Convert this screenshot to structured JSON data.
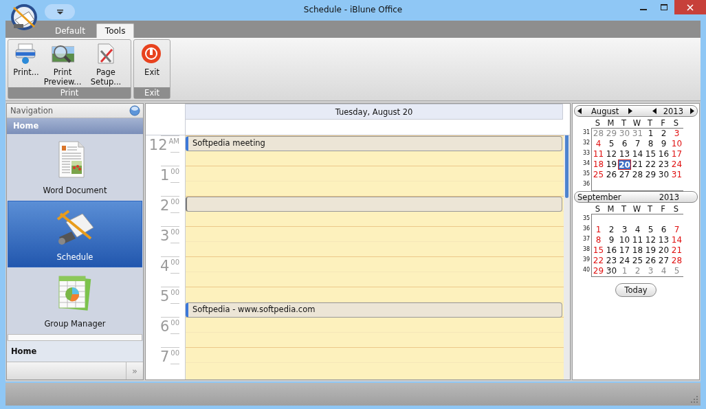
{
  "window": {
    "title": "Schedule - iBlune Office"
  },
  "ribbon": {
    "tabs": [
      {
        "label": "Default",
        "selected": false
      },
      {
        "label": "Tools",
        "selected": true
      }
    ],
    "groups": [
      {
        "label": "Print",
        "buttons": [
          {
            "label": "Print...",
            "kind": "printer"
          },
          {
            "label": "Print Preview...",
            "kind": "preview"
          },
          {
            "label": "Page Setup...",
            "kind": "setup"
          }
        ]
      },
      {
        "label": "Exit",
        "buttons": [
          {
            "label": "Exit",
            "kind": "exit"
          }
        ]
      }
    ]
  },
  "navigation": {
    "title": "Navigation",
    "section": "Home",
    "items": [
      {
        "label": "Word Document",
        "kind": "document",
        "selected": false
      },
      {
        "label": "Schedule",
        "kind": "schedule",
        "selected": true
      },
      {
        "label": "Group Manager",
        "kind": "spreadsheet",
        "selected": false
      }
    ],
    "footer": "Home",
    "more_button": "»"
  },
  "day_view": {
    "date": "Tuesday, August 20",
    "hours": [
      {
        "hour": "12",
        "suffix": "AM",
        "slots": [
          {
            "booked": true,
            "subject": "Softpedia meeting"
          },
          {
            "booked": false
          }
        ]
      },
      {
        "hour": "1",
        "suffix": "00",
        "slots": [
          {
            "booked": false
          },
          {
            "booked": false
          }
        ]
      },
      {
        "hour": "2",
        "suffix": "00",
        "slots": [
          {
            "booked": true
          },
          {
            "booked": false
          }
        ]
      },
      {
        "hour": "3",
        "suffix": "00",
        "slots": [
          {
            "booked": false
          },
          {
            "booked": false
          }
        ]
      },
      {
        "hour": "4",
        "suffix": "00",
        "slots": [
          {
            "booked": false
          },
          {
            "booked": false
          }
        ]
      },
      {
        "hour": "5",
        "suffix": "00",
        "slots": [
          {
            "booked": false
          },
          {
            "booked": true,
            "subject": "Softpedia - www.softpedia.com"
          }
        ]
      },
      {
        "hour": "6",
        "suffix": "00",
        "slots": [
          {
            "booked": false
          },
          {
            "booked": false
          }
        ]
      },
      {
        "hour": "7",
        "suffix": "00",
        "slots": [
          {
            "booked": false
          },
          {
            "booked": false
          }
        ]
      }
    ]
  },
  "mini_calendars": [
    {
      "month": "August",
      "year": "2013",
      "arrows": true,
      "weekdays": [
        "S",
        "M",
        "T",
        "W",
        "T",
        "F",
        "S"
      ],
      "weeks": [
        {
          "number": "31",
          "days": [
            {
              "d": "28",
              "kind": "other",
              "selected": false
            },
            {
              "d": "29",
              "kind": "other",
              "selected": false
            },
            {
              "d": "30",
              "kind": "other",
              "selected": false
            },
            {
              "d": "31",
              "kind": "other",
              "selected": false
            },
            {
              "d": "1",
              "kind": "weekday",
              "selected": false
            },
            {
              "d": "2",
              "kind": "weekday",
              "selected": false
            },
            {
              "d": "3",
              "kind": "weekend",
              "selected": false
            }
          ]
        },
        {
          "number": "32",
          "days": [
            {
              "d": "4",
              "kind": "weekend",
              "selected": false
            },
            {
              "d": "5",
              "kind": "weekday",
              "selected": false
            },
            {
              "d": "6",
              "kind": "weekday",
              "selected": false
            },
            {
              "d": "7",
              "kind": "weekday",
              "selected": false
            },
            {
              "d": "8",
              "kind": "weekday",
              "selected": false
            },
            {
              "d": "9",
              "kind": "weekday",
              "selected": false
            },
            {
              "d": "10",
              "kind": "weekend",
              "selected": false
            }
          ]
        },
        {
          "number": "33",
          "days": [
            {
              "d": "11",
              "kind": "weekend",
              "selected": false
            },
            {
              "d": "12",
              "kind": "weekday",
              "selected": false
            },
            {
              "d": "13",
              "kind": "weekday",
              "selected": false
            },
            {
              "d": "14",
              "kind": "weekday",
              "selected": false
            },
            {
              "d": "15",
              "kind": "weekday",
              "selected": false
            },
            {
              "d": "16",
              "kind": "weekday",
              "selected": false
            },
            {
              "d": "17",
              "kind": "weekend",
              "selected": false
            }
          ]
        },
        {
          "number": "34",
          "days": [
            {
              "d": "18",
              "kind": "weekend",
              "selected": false
            },
            {
              "d": "19",
              "kind": "weekday",
              "selected": false
            },
            {
              "d": "20",
              "kind": "weekday",
              "selected": true
            },
            {
              "d": "21",
              "kind": "weekday",
              "selected": false
            },
            {
              "d": "22",
              "kind": "weekday",
              "selected": false
            },
            {
              "d": "23",
              "kind": "weekday",
              "selected": false
            },
            {
              "d": "24",
              "kind": "weekend",
              "selected": false
            }
          ]
        },
        {
          "number": "35",
          "days": [
            {
              "d": "25",
              "kind": "weekend",
              "selected": false
            },
            {
              "d": "26",
              "kind": "weekday",
              "selected": false
            },
            {
              "d": "27",
              "kind": "weekday",
              "selected": false
            },
            {
              "d": "28",
              "kind": "weekday",
              "selected": false
            },
            {
              "d": "29",
              "kind": "weekday",
              "selected": false
            },
            {
              "d": "30",
              "kind": "weekday",
              "selected": false
            },
            {
              "d": "31",
              "kind": "weekend",
              "selected": false
            }
          ]
        },
        {
          "number": "36"
        }
      ]
    },
    {
      "month": "September",
      "year": "2013",
      "arrows": false,
      "weekdays": [
        "S",
        "M",
        "T",
        "W",
        "T",
        "F",
        "S"
      ],
      "weeks": [
        {
          "number": "35"
        },
        {
          "number": "36",
          "days": [
            {
              "d": "1",
              "kind": "weekend",
              "selected": false
            },
            {
              "d": "2",
              "kind": "weekday",
              "selected": false
            },
            {
              "d": "3",
              "kind": "weekday",
              "selected": false
            },
            {
              "d": "4",
              "kind": "weekday",
              "selected": false
            },
            {
              "d": "5",
              "kind": "weekday",
              "selected": false
            },
            {
              "d": "6",
              "kind": "weekday",
              "selected": false
            },
            {
              "d": "7",
              "kind": "weekend",
              "selected": false
            }
          ]
        },
        {
          "number": "37",
          "days": [
            {
              "d": "8",
              "kind": "weekend",
              "selected": false
            },
            {
              "d": "9",
              "kind": "weekday",
              "selected": false
            },
            {
              "d": "10",
              "kind": "weekday",
              "selected": false
            },
            {
              "d": "11",
              "kind": "weekday",
              "selected": false
            },
            {
              "d": "12",
              "kind": "weekday",
              "selected": false
            },
            {
              "d": "13",
              "kind": "weekday",
              "selected": false
            },
            {
              "d": "14",
              "kind": "weekend",
              "selected": false
            }
          ]
        },
        {
          "number": "38",
          "days": [
            {
              "d": "15",
              "kind": "weekend",
              "selected": false
            },
            {
              "d": "16",
              "kind": "weekday",
              "selected": false
            },
            {
              "d": "17",
              "kind": "weekday",
              "selected": false
            },
            {
              "d": "18",
              "kind": "weekday",
              "selected": false
            },
            {
              "d": "19",
              "kind": "weekday",
              "selected": false
            },
            {
              "d": "20",
              "kind": "weekday",
              "selected": false
            },
            {
              "d": "21",
              "kind": "weekend",
              "selected": false
            }
          ]
        },
        {
          "number": "39",
          "days": [
            {
              "d": "22",
              "kind": "weekend",
              "selected": false
            },
            {
              "d": "23",
              "kind": "weekday",
              "selected": false
            },
            {
              "d": "24",
              "kind": "weekday",
              "selected": false
            },
            {
              "d": "25",
              "kind": "weekday",
              "selected": false
            },
            {
              "d": "26",
              "kind": "weekday",
              "selected": false
            },
            {
              "d": "27",
              "kind": "weekday",
              "selected": false
            },
            {
              "d": "28",
              "kind": "weekend",
              "selected": false
            }
          ]
        },
        {
          "number": "40",
          "days": [
            {
              "d": "29",
              "kind": "weekend",
              "selected": false
            },
            {
              "d": "30",
              "kind": "weekday",
              "selected": false
            },
            {
              "d": "1",
              "kind": "other",
              "selected": false
            },
            {
              "d": "2",
              "kind": "other",
              "selected": false
            },
            {
              "d": "3",
              "kind": "other",
              "selected": false
            },
            {
              "d": "4",
              "kind": "other",
              "selected": false
            },
            {
              "d": "5",
              "kind": "other",
              "selected": false
            }
          ]
        }
      ]
    }
  ],
  "today_button": "Today"
}
